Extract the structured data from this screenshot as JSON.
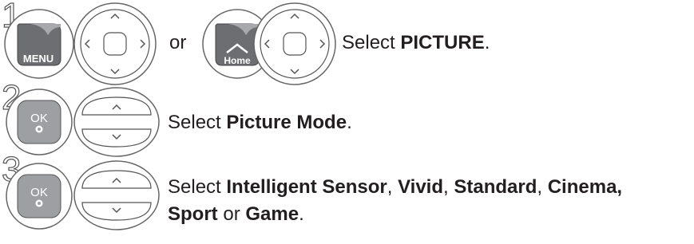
{
  "step1": {
    "number": "1",
    "menu_label": "MENU",
    "or_text": "or",
    "home_label": "Home",
    "instruction_prefix": "Select ",
    "instruction_bold": "PICTURE",
    "instruction_suffix": "."
  },
  "step2": {
    "number": "2",
    "ok_label": "OK",
    "instruction_prefix": "Select ",
    "instruction_bold": "Picture Mode",
    "instruction_suffix": "."
  },
  "step3": {
    "number": "3",
    "ok_label": "OK",
    "line1_prefix": "Select ",
    "line1_bold1": "Intelligent Sensor",
    "line1_sep1": ", ",
    "line1_bold2": "Vivid",
    "line1_sep2": ", ",
    "line1_bold3": "Standard",
    "line1_sep3": ", ",
    "line1_bold4": "Cinema,",
    "line2_bold1": "Sport",
    "line2_mid": " or ",
    "line2_bold2": "Game",
    "line2_suffix": "."
  }
}
